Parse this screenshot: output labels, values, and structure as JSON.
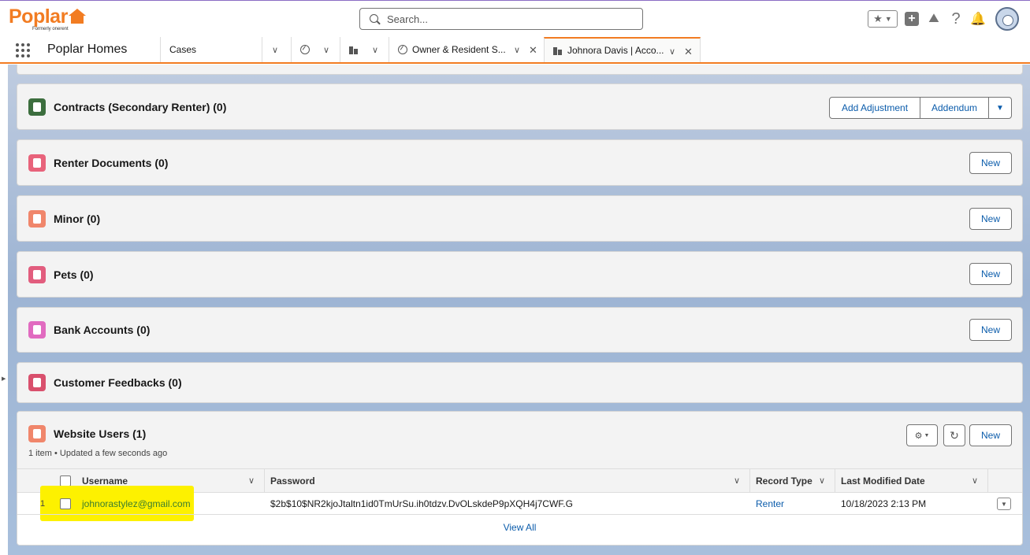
{
  "header": {
    "logo_text": "Poplar",
    "logo_sub": "Formerly onerent",
    "search_placeholder": "Search..."
  },
  "nav": {
    "app_name": "Poplar Homes",
    "tabs": [
      {
        "label": "Cases"
      },
      {
        "label": ""
      },
      {
        "label": ""
      },
      {
        "label": "Owner & Resident S..."
      },
      {
        "label": "Johnora Davis | Acco..."
      }
    ]
  },
  "cards": {
    "contracts": {
      "title": "Contracts (Secondary Renter) (0)",
      "btn1": "Add Adjustment",
      "btn2": "Addendum"
    },
    "renter_documents": {
      "title": "Renter Documents (0)",
      "btn": "New"
    },
    "minor": {
      "title": "Minor (0)",
      "btn": "New"
    },
    "pets": {
      "title": "Pets (0)",
      "btn": "New"
    },
    "bank_accounts": {
      "title": "Bank Accounts (0)",
      "btn": "New"
    },
    "customer_feedbacks": {
      "title": "Customer Feedbacks (0)"
    },
    "website_users": {
      "title": "Website Users (1)",
      "subline": "1 item • Updated a few seconds ago",
      "btn": "New",
      "columns": [
        "Username",
        "Password",
        "Record Type",
        "Last Modified Date"
      ],
      "rows": [
        {
          "num": "1",
          "username": "johnorastylez@gmail.com",
          "password": "$2b$10$NR2kjoJtaltn1id0TmUrSu.ih0tdzv.DvOLskdeP9pXQH4j7CWF.G",
          "record_type": "Renter",
          "last_modified": "10/18/2023 2:13 PM"
        }
      ],
      "view_all": "View All"
    }
  },
  "colors": {
    "brand": "#f27c22",
    "link": "#0b5cab",
    "highlight": "#fdf100"
  }
}
